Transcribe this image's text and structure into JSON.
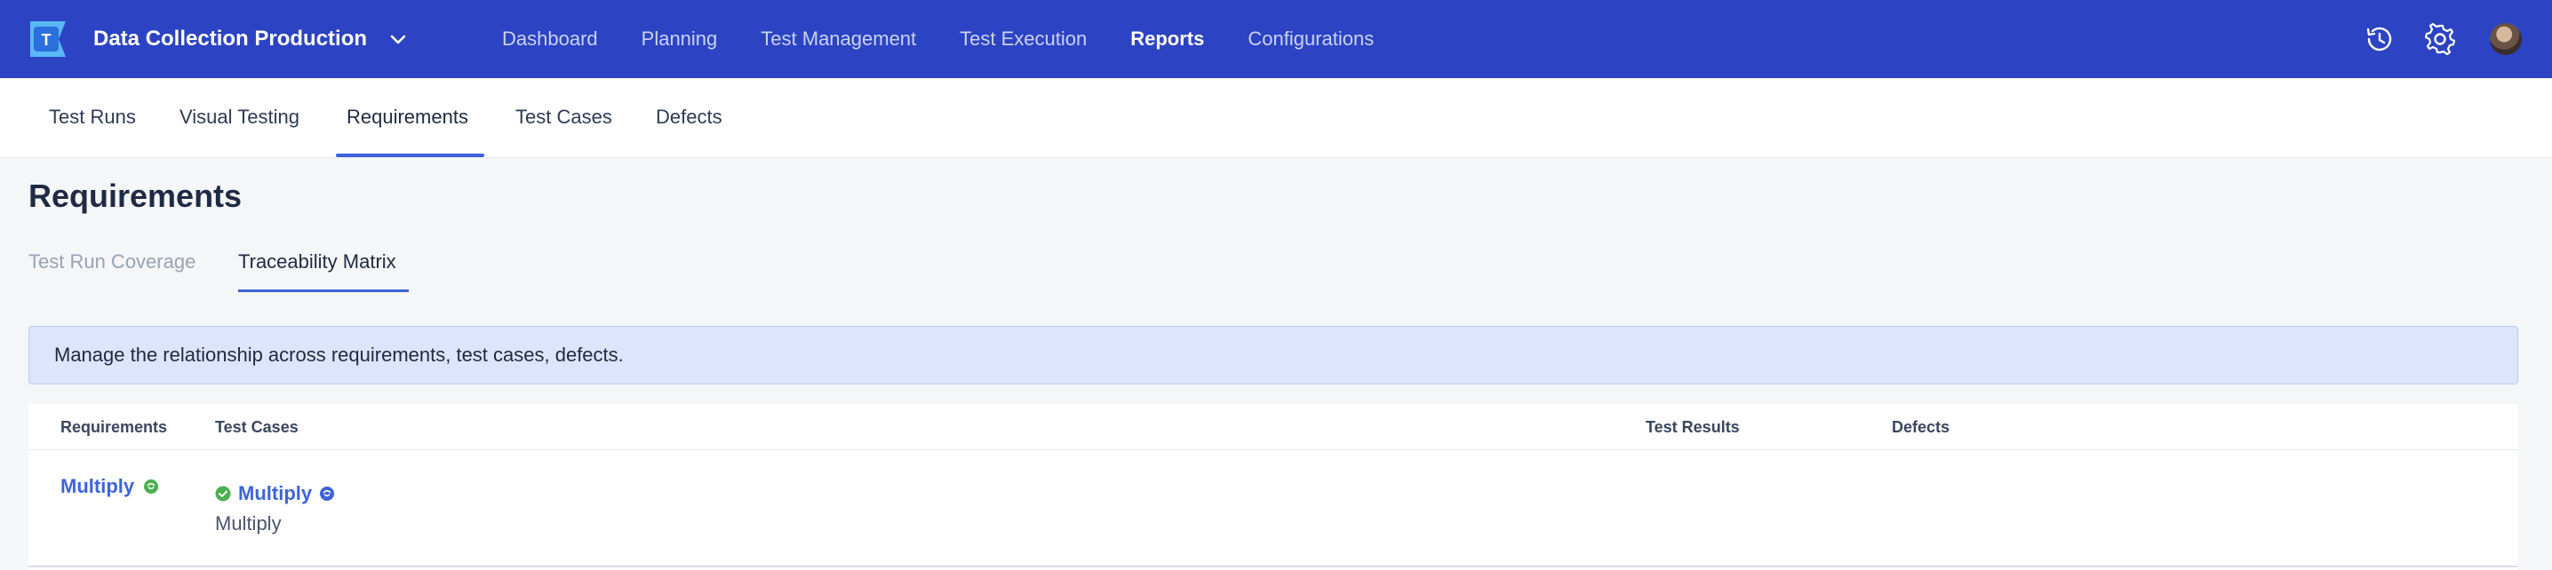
{
  "topbar": {
    "project_name": "Data Collection Production",
    "nav": [
      "Dashboard",
      "Planning",
      "Test Management",
      "Test Execution",
      "Reports",
      "Configurations"
    ],
    "active_nav": "Reports",
    "logo_letter": "T"
  },
  "subnav": {
    "items": [
      "Test Runs",
      "Visual Testing",
      "Requirements",
      "Test Cases",
      "Defects"
    ],
    "active": "Requirements"
  },
  "page": {
    "title": "Requirements",
    "tabs": [
      "Test Run Coverage",
      "Traceability Matrix"
    ],
    "active_tab": "Traceability Matrix",
    "banner": "Manage the relationship across requirements, test cases, defects."
  },
  "table": {
    "headers": [
      "Requirements",
      "Test Cases",
      "Test Results",
      "Defects"
    ],
    "rows": [
      {
        "requirement": "Multiply",
        "test_case": "Multiply",
        "test_case_sub": "Multiply",
        "test_results": "",
        "defects": ""
      }
    ]
  },
  "colors": {
    "topbar": "#2c44c3",
    "accent": "#3d63dd",
    "banner": "#dde4fb",
    "success": "#4caf50"
  },
  "icons": {
    "history": "history-icon",
    "settings": "gear-icon",
    "project_dropdown": "chevron-down-icon"
  }
}
